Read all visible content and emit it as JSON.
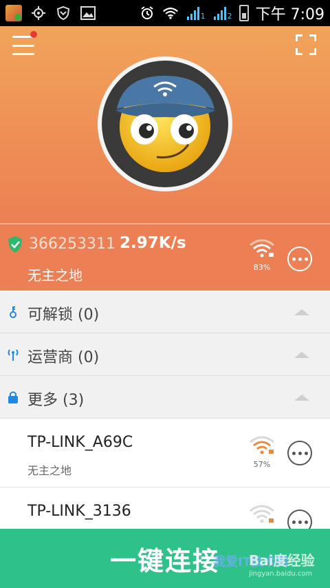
{
  "status_bar": {
    "time": "下午 7:09",
    "signal1_label": "1",
    "signal2_label": "2"
  },
  "hero": {
    "menu_has_notification": true
  },
  "current_connection": {
    "number": "366253311",
    "speed": "2.97K/s",
    "name": "无主之地",
    "signal_percent": "83%"
  },
  "sections": [
    {
      "label": "可解锁 (0)",
      "icon": "key-icon"
    },
    {
      "label": "运营商 (0)",
      "icon": "antenna-icon"
    },
    {
      "label": "更多 (3)",
      "icon": "lock-icon"
    }
  ],
  "networks": [
    {
      "ssid": "TP-LINK_A69C",
      "subtitle": "无主之地",
      "signal_percent": "57%"
    },
    {
      "ssid": "TP-LINK_3136",
      "subtitle": "",
      "signal_percent": ""
    }
  ],
  "connect_button": {
    "label": "一键连接"
  },
  "watermark": {
    "logo_text": "Bai度经验",
    "site": "jingyan.baidu.com",
    "overlay": "我爱IT技术网"
  },
  "colors": {
    "accent_orange": "#ec8054",
    "connect_green": "#2fc18a",
    "lock_orange": "#f0883a"
  }
}
